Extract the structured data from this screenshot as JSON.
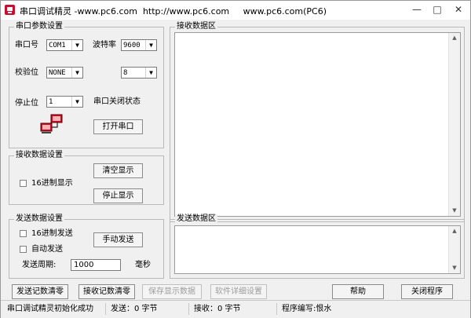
{
  "window": {
    "title": "串口调试精灵 -www.pc6.com  http://www.pc6.com     www.pc6.com(PC6)",
    "minimize": "—",
    "maximize": "□",
    "close": "✕"
  },
  "serial_params": {
    "group_title": "串口参数设置",
    "port_label": "串口号",
    "port_value": "COM1",
    "baud_label": "波特率",
    "baud_value": "9600",
    "parity_label": "校验位",
    "parity_value": "NONE",
    "databits_value": "8",
    "stopbits_label": "停止位",
    "stopbits_value": "1",
    "status_text": "串口关闭状态",
    "open_button": "打开串口",
    "icon": "computer-network-icon"
  },
  "receive_settings": {
    "group_title": "接收数据设置",
    "hex_display_label": "16进制显示",
    "clear_button": "清空显示",
    "stop_button": "停止显示"
  },
  "send_settings": {
    "group_title": "发送数据设置",
    "hex_send_label": "16进制发送",
    "auto_send_label": "自动发送",
    "manual_send_button": "手动发送",
    "period_label": "发送周期:",
    "period_value": "1000",
    "period_unit": "毫秒"
  },
  "receive_area": {
    "group_title": "接收数据区"
  },
  "send_area": {
    "group_title": "发送数据区"
  },
  "bottom_buttons": {
    "clear_send_count": "发送记数清零",
    "clear_recv_count": "接收记数清零",
    "save_display": "保存显示数据",
    "software_details": "软件详细设置",
    "help": "帮助",
    "close_program": "关闭程序"
  },
  "status_bar": {
    "message": "串口调试精灵初始化成功",
    "sent": "发送：0 字节",
    "received": "接收：0 字节",
    "author": "程序编写:恨水"
  },
  "colors": {
    "accent": "#c8102e",
    "window_bg": "#f0f0f0"
  }
}
